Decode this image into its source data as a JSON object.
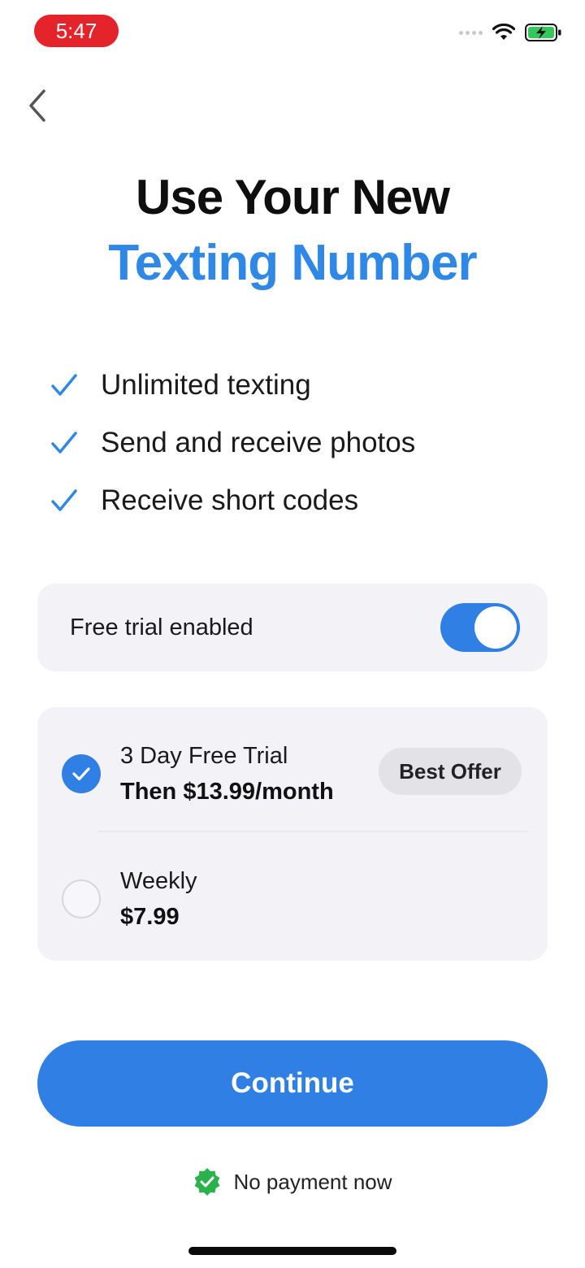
{
  "status_bar": {
    "time": "5:47",
    "battery_color": "#34c759",
    "time_pill_color": "#e5232b"
  },
  "title": {
    "line1": "Use Your New",
    "line2": "Texting Number"
  },
  "features": [
    {
      "icon": "checkmark-icon",
      "label": "Unlimited texting"
    },
    {
      "icon": "checkmark-icon",
      "label": "Send and receive photos"
    },
    {
      "icon": "checkmark-icon",
      "label": "Receive short codes"
    }
  ],
  "trial_toggle": {
    "label": "Free trial enabled",
    "enabled": true
  },
  "plans": [
    {
      "name": "3 Day Free Trial",
      "price": "Then $13.99/month",
      "badge": "Best Offer",
      "selected": true
    },
    {
      "name": "Weekly",
      "price": "$7.99",
      "selected": false
    }
  ],
  "continue_button": {
    "label": "Continue"
  },
  "footer": {
    "label": "No payment now",
    "icon": "verified-badge-icon"
  },
  "colors": {
    "accent": "#2f7fe4",
    "title_accent": "#2f87e6",
    "card_bg": "#f3f3f7",
    "verified_green": "#2bb24c"
  }
}
